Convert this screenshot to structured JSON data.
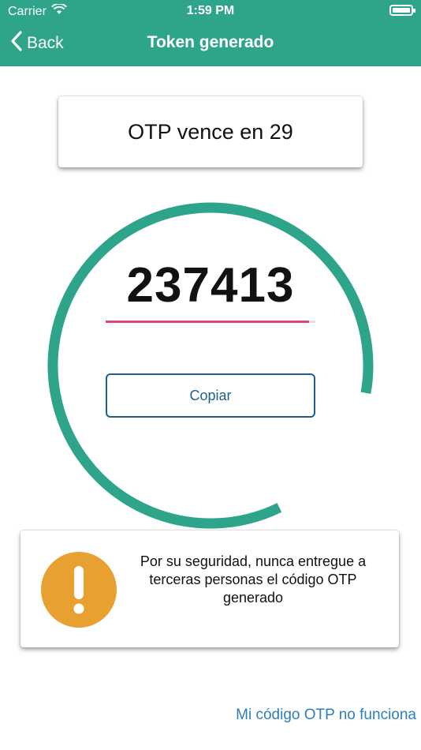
{
  "status_bar": {
    "carrier": "Carrier",
    "time": "1:59 PM"
  },
  "nav": {
    "back_label": "Back",
    "title": "Token generado"
  },
  "timer": {
    "text": "OTP vence en 29",
    "seconds_remaining": 29
  },
  "otp": {
    "code": "237413",
    "ring_progress": 0.97,
    "underline_progress": 0.97
  },
  "actions": {
    "copy_label": "Copiar"
  },
  "warning": {
    "text": "Por su seguridad, nunca entregue a terceras personas el código OTP generado"
  },
  "help": {
    "link_label": "Mi código OTP no funciona"
  },
  "colors": {
    "header": "#2ea58a",
    "ring": "#2ea58a",
    "underline": "#e0447f",
    "button": "#1f5f8b",
    "warning_icon": "#e8a030",
    "link": "#2c7fbf"
  }
}
